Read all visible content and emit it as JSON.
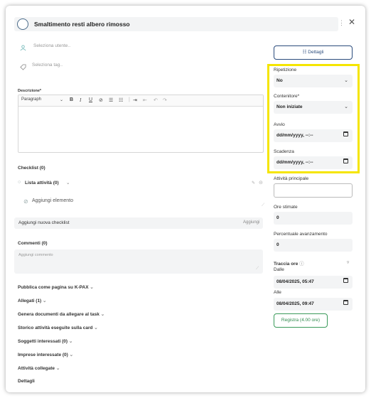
{
  "card": {
    "title": "Smaltimento resti albero rimosso",
    "kebab_glyph": "⋮",
    "close_glyph": "✕"
  },
  "left": {
    "select_user_placeholder": "Seleziona utente..",
    "select_tag_placeholder": "Seleziona tag..",
    "description_label": "Descrizione*",
    "editor": {
      "paragraph_select": "Paragraph"
    },
    "checklist_header": "Checklist (0)",
    "activity_list_label": "Lista attività (0)",
    "add_element_label": "Aggiungi elemento",
    "new_checklist_placeholder": "Aggiungi nuova checklist",
    "add_button": "Aggiungi",
    "comments_header": "Commenti (0)",
    "comment_placeholder": "Aggiungi commento",
    "sections": [
      "Pubblica come pagina su K-PAX",
      "Allegati (1)",
      "Genera documenti da allegare al task",
      "Storico attività eseguite sulla card",
      "Soggetti interessati (0)",
      "Imprese interessate (0)",
      "Attività collegate",
      "Dettagli"
    ]
  },
  "right": {
    "details_button": "Dettagli",
    "repetition_label": "Ripetizione",
    "repetition_value": "No",
    "container_label": "Contenitore*",
    "container_value": "Non iniziate",
    "start_label": "Avvio",
    "start_value": "dd/mm/yyyy, --:--",
    "due_label": "Scadenza",
    "due_value": "dd/mm/yyyy, --:--",
    "parent_activity_label": "Attività principale",
    "estimated_hours_label": "Ore stimate",
    "estimated_hours_value": "0",
    "progress_label": "Percentuale avanzamento",
    "progress_value": "0",
    "track_time_label": "Traccia ore",
    "from_label": "Dalle",
    "from_value": "08/04/2025, 05:47",
    "to_label": "Alle",
    "to_value": "08/04/2025, 09:47",
    "register_button": "Registra (4.00 ore)"
  },
  "colors": {
    "highlight": "#f5e500",
    "primary": "#2a4b7c",
    "register": "#3a9a5a"
  }
}
